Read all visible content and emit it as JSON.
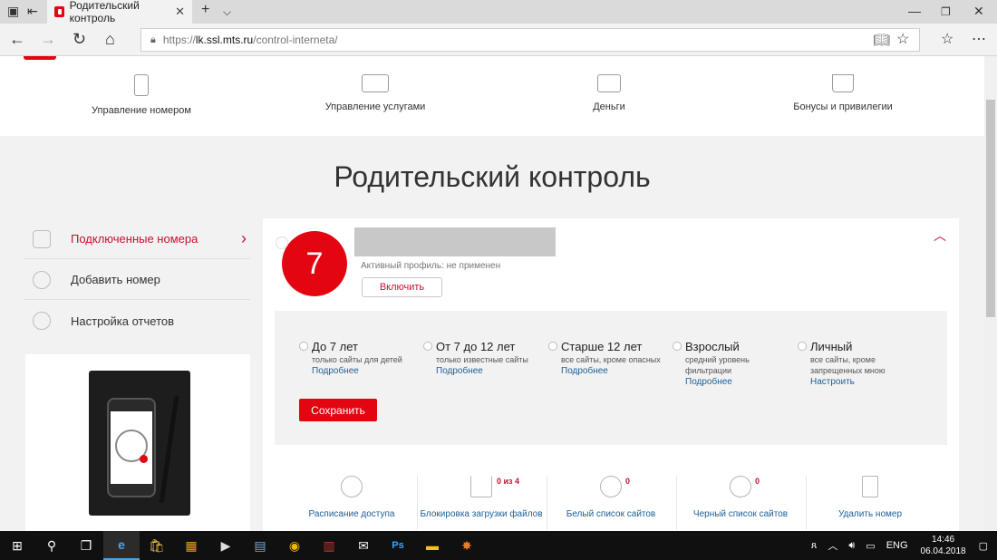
{
  "browser": {
    "tab_title": "Родительский контроль",
    "url_scheme": "https://",
    "url_host": "lk.ssl.mts.ru",
    "url_path": "/control-interneta/"
  },
  "topnav": {
    "items": [
      {
        "label": "Управление номером",
        "icon": "phone-icon"
      },
      {
        "label": "Управление услугами",
        "icon": "laptop-icon"
      },
      {
        "label": "Деньги",
        "icon": "wallet-icon"
      },
      {
        "label": "Бонусы и привилегии",
        "icon": "cart-icon"
      }
    ]
  },
  "page_title": "Родительский контроль",
  "sidebar": {
    "items": [
      {
        "label": "Подключенные номера",
        "active": true
      },
      {
        "label": "Добавить номер"
      },
      {
        "label": "Настройка отчетов"
      }
    ]
  },
  "profile": {
    "number_badge": "7",
    "status": "Активный профиль: не применен",
    "enable_label": "Включить"
  },
  "filters": [
    {
      "title": "До 7 лет",
      "desc": "только сайты для детей",
      "link": "Подробнее"
    },
    {
      "title": "От 7 до 12 лет",
      "desc": "только известные сайты",
      "link": "Подробнее"
    },
    {
      "title": "Старше 12 лет",
      "desc": "все сайты, кроме опасных",
      "link": "Подробнее"
    },
    {
      "title": "Взрослый",
      "desc": "средний уровень фильтрации",
      "link": "Подробнее"
    },
    {
      "title": "Личный",
      "desc": "все сайты, кроме запрещенных мною",
      "link": "Настроить"
    }
  ],
  "save_label": "Сохранить",
  "actions": [
    {
      "label": "Расписание доступа",
      "icon": "clock-icon",
      "count": ""
    },
    {
      "label": "Блокировка загрузки файлов",
      "icon": "download-icon",
      "count": "0 из 4"
    },
    {
      "label": "Белый список сайтов",
      "icon": "check-icon",
      "count": "0"
    },
    {
      "label": "Черный список сайтов",
      "icon": "cross-icon",
      "count": "0"
    },
    {
      "label": "Удалить номер",
      "icon": "trash-icon",
      "count": ""
    }
  ],
  "taskbar": {
    "lang": "ENG",
    "time": "14:46",
    "date": "06.04.2018"
  },
  "colors": {
    "accent": "#e30611",
    "link": "#1a5f9a"
  }
}
